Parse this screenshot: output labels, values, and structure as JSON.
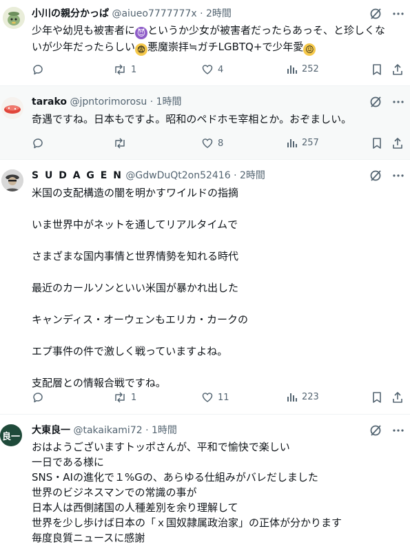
{
  "posts": [
    {
      "name": "小川の親分かっぱ",
      "handle": "@aiueo7777777x",
      "dot": "·",
      "time": "2時間",
      "lines": [
        [
          "少年や幼児も被害者に",
          "というか少女が被害者だったらあっそ、と珍しくな"
        ],
        [
          "いが少年だったらしい",
          "悪魔崇拝≒ガチLGBTQ+で少年愛"
        ]
      ],
      "emojis": [
        "devil-emoji",
        "anxious-face-emoji",
        "confounded-face-emoji"
      ],
      "replies": "",
      "reposts": "1",
      "likes": "4",
      "views": "252"
    },
    {
      "name": "tarako",
      "handle": "@jpntorimorosu",
      "dot": "·",
      "time": "1時間",
      "lines": [
        "奇遇ですね。日本もですよ。昭和のペドホモ宰相とか。おぞましい。"
      ],
      "replies": "",
      "reposts": "",
      "likes": "8",
      "views": "257"
    },
    {
      "name": "S U D A  G E N",
      "handle": "@GdwDuQt2on52416",
      "dot": "·",
      "time": "2時間",
      "lines": [
        "米国の支配構造の闇を明かすワイルドの指摘",
        "いま世界中がネットを通してリアルタイムで",
        "さまざまな国内事情と世界情勢を知れる時代",
        "最近のカールソンといい米国が暴かれ出した",
        "キャンディス・オーウェンもエリカ・カークの",
        "エプ事件の件で激しく戦っていますよね。",
        "支配層との情報合戦ですね。"
      ],
      "replies": "",
      "reposts": "1",
      "likes": "11",
      "views": "223"
    },
    {
      "name": "大東良一",
      "handle": "@takaikami72",
      "dot": "·",
      "time": "1時間",
      "avatar_text": "良一",
      "lines": [
        "おはようございますトッポさんが、平和で愉快で楽しい",
        "一日である様に",
        "SNS・AIの進化で１%Gの、あらゆる仕組みがバレだしました",
        "世界のビジネスマンでの常識の事が",
        "日本人は西側諸国の人種差別を余り理解して",
        "世界を少し歩けば日本の「ｘ国奴隷属政治家」の正体が分かります",
        "毎度良質ニュースに感謝"
      ]
    }
  ],
  "icons": {
    "grok": "grok-slash-icon",
    "more": "more-dots-icon",
    "reply": "reply-bubble-icon",
    "repost": "repost-arrows-icon",
    "like": "heart-icon",
    "views": "views-bar-chart-icon",
    "bookmark": "bookmark-icon",
    "share": "share-upload-icon"
  },
  "colors": {
    "text": "#0f1419",
    "muted": "#536471",
    "divider": "#eff3f4",
    "highlight_bg": "#f7f9f9",
    "avatar4_bg": "#1f4a3a"
  }
}
